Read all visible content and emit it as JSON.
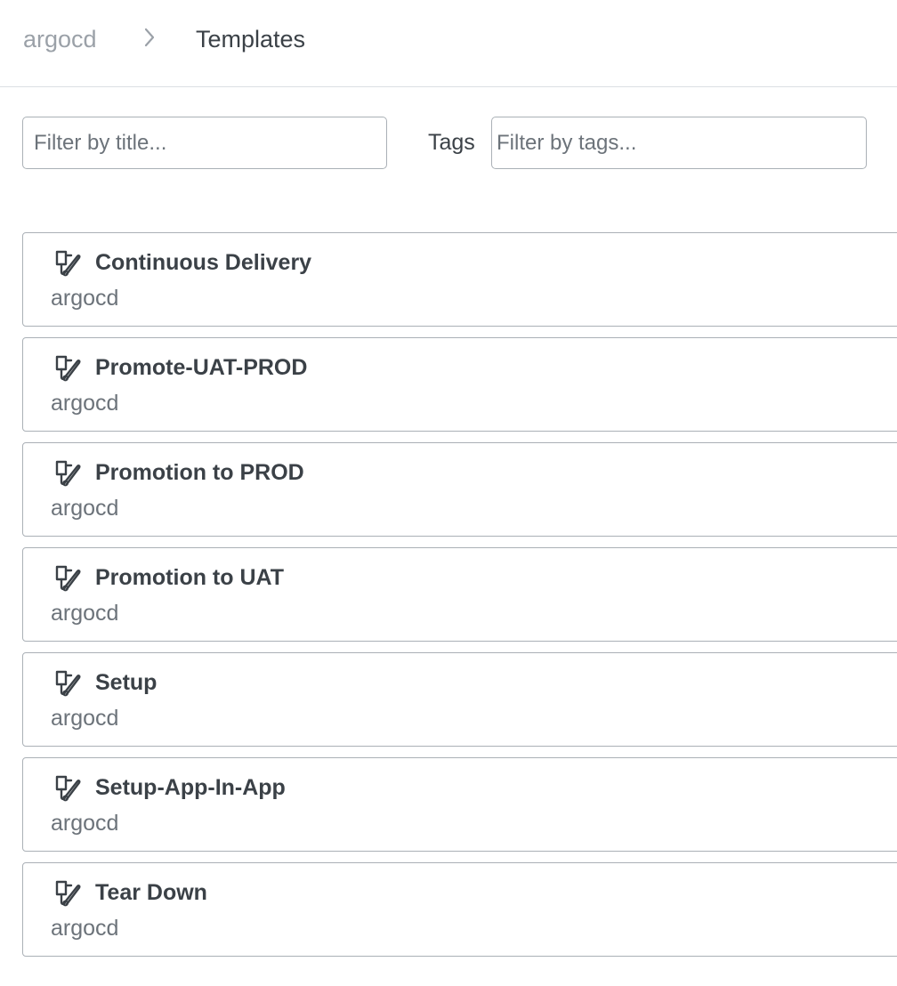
{
  "breadcrumb": {
    "root": "argocd",
    "current": "Templates"
  },
  "filters": {
    "title_placeholder": "Filter by title...",
    "title_value": "",
    "tags_label": "Tags",
    "tags_placeholder": "Filter by tags...",
    "tags_value": ""
  },
  "icons": {
    "breadcrumb_separator": "chevron-right-icon",
    "template": "template-icon"
  },
  "colors": {
    "text_primary": "#3b4147",
    "text_muted": "#6c737a",
    "text_breadcrumb_root": "#9ba1a8",
    "border": "#aab0b6",
    "divider": "#dcdfe3"
  },
  "templates": [
    {
      "title": "Continuous Delivery",
      "namespace": "argocd"
    },
    {
      "title": "Promote-UAT-PROD",
      "namespace": "argocd"
    },
    {
      "title": "Promotion to PROD",
      "namespace": "argocd"
    },
    {
      "title": "Promotion to UAT",
      "namespace": "argocd"
    },
    {
      "title": "Setup",
      "namespace": "argocd"
    },
    {
      "title": "Setup-App-In-App",
      "namespace": "argocd"
    },
    {
      "title": "Tear Down",
      "namespace": "argocd"
    }
  ]
}
